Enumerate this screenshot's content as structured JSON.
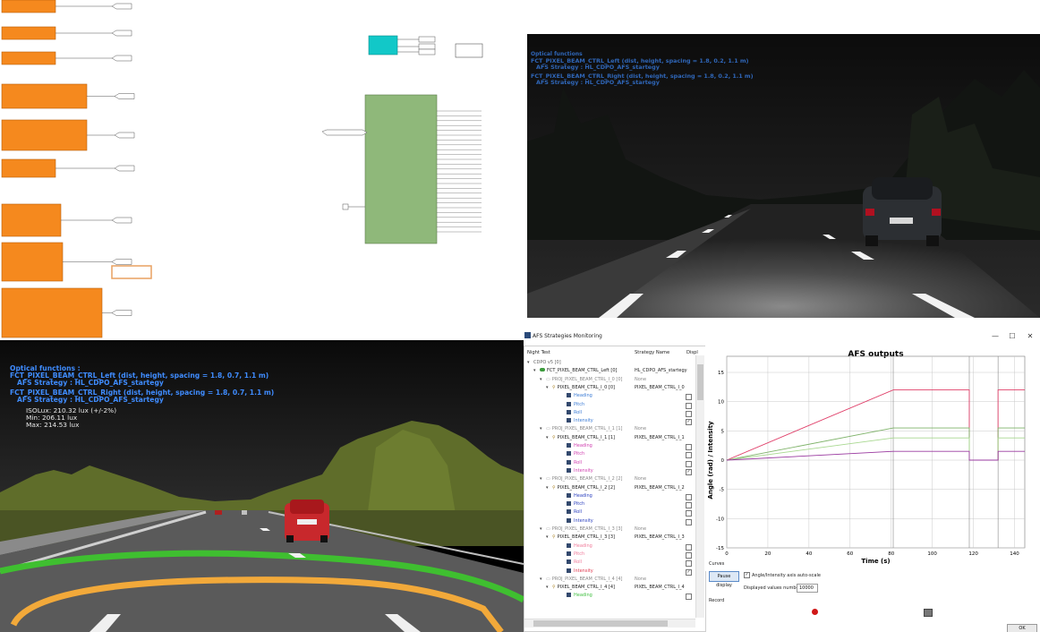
{
  "quadrant_bottom_left": {
    "osd_header": "Optical functions :",
    "left_function": "FCT_PIXEL_BEAM_CTRL_Left (dist, height, spacing = 1.8, 0.7, 1.1 m)",
    "left_strategy": "AFS Strategy : HL_CDPO_AFS_startegy",
    "right_function": "FCT_PIXEL_BEAM_CTRL_Right (dist, height, spacing = 1.8, 0.7, 1.1 m)",
    "right_strategy": "AFS Strategy : HL_CDPO_AFS_startegy",
    "isolux": "ISOLux: 210.32 lux (+/-2%)",
    "min": "Min: 206.11 lux",
    "max": "Max: 214.53 lux"
  },
  "quadrant_top_right": {
    "osd_header": "Optical functions",
    "left_function": "FCT_PIXEL_BEAM_CTRL_Left (dist, height, spacing = 1.8, 0.2, 1.1 m)",
    "left_strategy": "AFS Strategy : HL_CDPO_AFS_startegy",
    "right_function": "FCT_PIXEL_BEAM_CTRL_Right (dist, height, spacing = 1.8, 0.2, 1.1 m)",
    "right_strategy": "AFS Strategy : HL_CDPO_AFS_startegy"
  },
  "monitor": {
    "window_title": "AFS Strategies Monitoring",
    "buttons": {
      "minimize": "—",
      "maximize": "☐",
      "close": "✕"
    },
    "columns": [
      "Night Test",
      "Strategy Name",
      "Displ"
    ],
    "tree": {
      "root": "CDPO v5 [0]",
      "function": {
        "label": "FCT_PIXEL_BEAM_CTRL_Left [0]",
        "strategy": "HL_CDPO_AFS_startegy"
      },
      "groups": [
        {
          "proj": "PROJ_PIXEL_BEAM_CTRL_I_0 [0]",
          "proj_strategy": "None",
          "ctrl": "PIXEL_BEAM_CTRL_I_0 [0]",
          "ctrl_strategy": "PIXEL_BEAM_CTRL_I_0",
          "items": [
            {
              "label": "Heading",
              "color": "#3a7bd5",
              "checked": false
            },
            {
              "label": "Pitch",
              "color": "#3a7bd5",
              "checked": false
            },
            {
              "label": "Roll",
              "color": "#3a7bd5",
              "checked": false
            },
            {
              "label": "Intensity",
              "color": "#3a7bd5",
              "checked": true
            }
          ]
        },
        {
          "proj": "PROJ_PIXEL_BEAM_CTRL_I_1 [1]",
          "proj_strategy": "None",
          "ctrl": "PIXEL_BEAM_CTRL_I_1 [1]",
          "ctrl_strategy": "PIXEL_BEAM_CTRL_I_1",
          "items": [
            {
              "label": "Heading",
              "color": "#d040b0",
              "checked": false
            },
            {
              "label": "Pitch",
              "color": "#d040b0",
              "checked": false
            },
            {
              "label": "Roll",
              "color": "#d040b0",
              "checked": false
            },
            {
              "label": "Intensity",
              "color": "#d040b0",
              "checked": true
            }
          ]
        },
        {
          "proj": "PROJ_PIXEL_BEAM_CTRL_I_2 [2]",
          "proj_strategy": "None",
          "ctrl": "PIXEL_BEAM_CTRL_I_2 [2]",
          "ctrl_strategy": "PIXEL_BEAM_CTRL_I_2",
          "items": [
            {
              "label": "Heading",
              "color": "#2a3fbf",
              "checked": false
            },
            {
              "label": "Pitch",
              "color": "#2a3fbf",
              "checked": false
            },
            {
              "label": "Roll",
              "color": "#2a3fbf",
              "checked": false
            },
            {
              "label": "Intensity",
              "color": "#2a3fbf",
              "checked": false
            }
          ]
        },
        {
          "proj": "PROJ_PIXEL_BEAM_CTRL_I_3 [3]",
          "proj_strategy": "None",
          "ctrl": "PIXEL_BEAM_CTRL_I_3 [3]",
          "ctrl_strategy": "PIXEL_BEAM_CTRL_I_3",
          "items": [
            {
              "label": "Heading",
              "color": "#f07a9a",
              "checked": false
            },
            {
              "label": "Pitch",
              "color": "#f07a9a",
              "checked": false
            },
            {
              "label": "Roll",
              "color": "#f07a9a",
              "checked": false
            },
            {
              "label": "Intensity",
              "color": "#e03a50",
              "checked": true
            }
          ]
        },
        {
          "proj": "PROJ_PIXEL_BEAM_CTRL_I_4 [4]",
          "proj_strategy": "None",
          "ctrl": "PIXEL_BEAM_CTRL_I_4 [4]",
          "ctrl_strategy": "PIXEL_BEAM_CTRL_I_4",
          "items": [
            {
              "label": "Heading",
              "color": "#3fbf3f",
              "checked": false
            }
          ]
        }
      ]
    },
    "curves_label": "Curves",
    "pause_button": "Pause display",
    "autoscale_label": "Angle/Intensity axis auto-scale",
    "displayed_values_label": "Displayed values number :",
    "displayed_values": "10000",
    "record_label": "Record",
    "ok_button": "OK"
  },
  "chart_data": {
    "type": "line",
    "title": "AFS outputs",
    "xlabel": "Time (s)",
    "ylabel": "Angle (rad) / Intensity",
    "xlim": [
      0,
      145
    ],
    "ylim": [
      -15,
      15
    ],
    "xticks": [
      0,
      20,
      40,
      60,
      80,
      100,
      120,
      140
    ],
    "yticks": [
      -15,
      -10,
      -5,
      0,
      5,
      10,
      15
    ],
    "grid": true,
    "series": [
      {
        "color": "#e0406a",
        "points": [
          [
            0,
            0
          ],
          [
            81,
            12
          ],
          [
            118,
            12
          ],
          [
            118,
            0
          ],
          [
            132,
            0
          ],
          [
            132,
            12
          ],
          [
            145,
            12
          ]
        ]
      },
      {
        "color": "#7fb36a",
        "points": [
          [
            0,
            0
          ],
          [
            81,
            5.5
          ],
          [
            118,
            5.5
          ],
          [
            118,
            0
          ],
          [
            132,
            0
          ],
          [
            132,
            5.5
          ],
          [
            145,
            5.5
          ]
        ]
      },
      {
        "color": "#a8d890",
        "points": [
          [
            0,
            0
          ],
          [
            81,
            3.8
          ],
          [
            118,
            3.8
          ],
          [
            118,
            0
          ],
          [
            132,
            0
          ],
          [
            132,
            3.8
          ],
          [
            145,
            3.8
          ]
        ]
      },
      {
        "color": "#9a3aa0",
        "points": [
          [
            0,
            0
          ],
          [
            81,
            1.5
          ],
          [
            118,
            1.5
          ],
          [
            118,
            0
          ],
          [
            132,
            0
          ],
          [
            132,
            1.5
          ],
          [
            145,
            1.5
          ]
        ]
      }
    ]
  }
}
